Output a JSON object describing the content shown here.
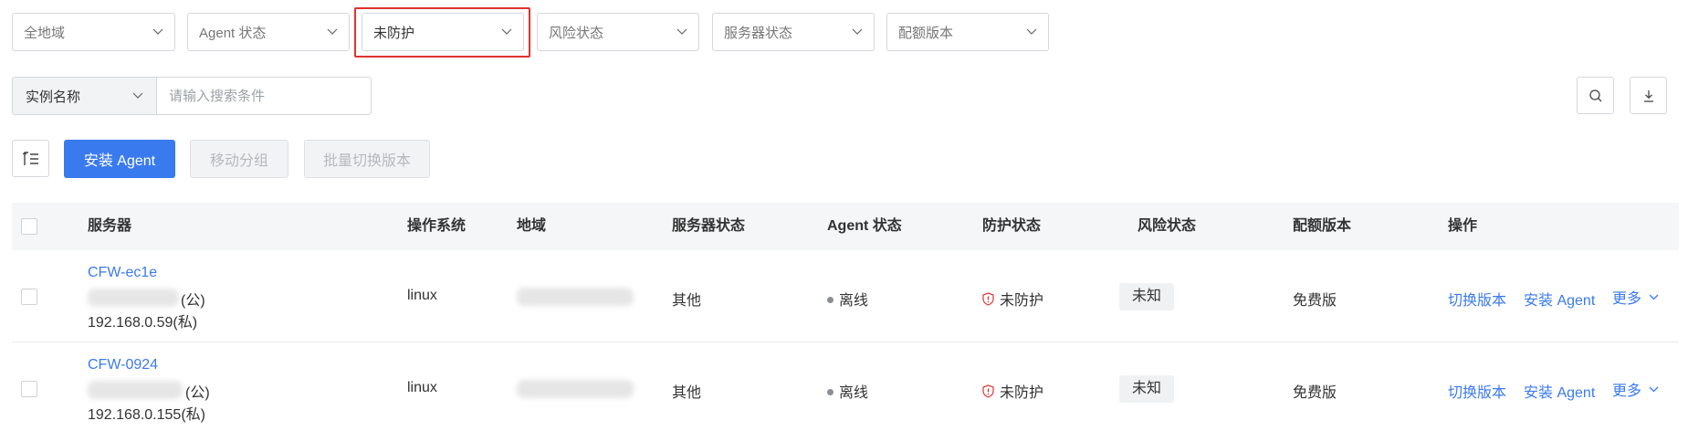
{
  "filters": [
    {
      "value": "全地域",
      "active": false
    },
    {
      "value": "Agent 状态",
      "active": false
    },
    {
      "value": "未防护",
      "active": true
    },
    {
      "value": "风险状态",
      "active": false
    },
    {
      "value": "服务器状态",
      "active": false
    },
    {
      "value": "配额版本",
      "active": false
    }
  ],
  "search": {
    "field": "实例名称",
    "placeholder": "请输入搜索条件"
  },
  "toolbar": {
    "install_label": "安装 Agent",
    "move_group_label": "移动分组",
    "batch_switch_label": "批量切换版本"
  },
  "table": {
    "columns": [
      "服务器",
      "操作系统",
      "地域",
      "服务器状态",
      "Agent 状态",
      "防护状态",
      "风险状态",
      "配额版本",
      "操作"
    ],
    "rows": [
      {
        "name": "CFW-ec1e",
        "public_suffix": "(公)",
        "private_ip": "192.168.0.59(私)",
        "os": "linux",
        "server_status": "其他",
        "agent_status": "离线",
        "protect_status": "未防护",
        "risk_status": "未知",
        "quota": "免费版",
        "action_switch": "切换版本",
        "action_install": "安装 Agent",
        "action_more": "更多"
      },
      {
        "name": "CFW-0924",
        "public_suffix": "(公)",
        "private_ip": "192.168.0.155(私)",
        "os": "linux",
        "server_status": "其他",
        "agent_status": "离线",
        "protect_status": "未防护",
        "risk_status": "未知",
        "quota": "免费版",
        "action_switch": "切换版本",
        "action_install": "安装 Agent",
        "action_more": "更多"
      }
    ]
  },
  "colors": {
    "accent": "#3a7aef",
    "highlight": "#e0322f",
    "danger_icon": "#e0322f"
  }
}
